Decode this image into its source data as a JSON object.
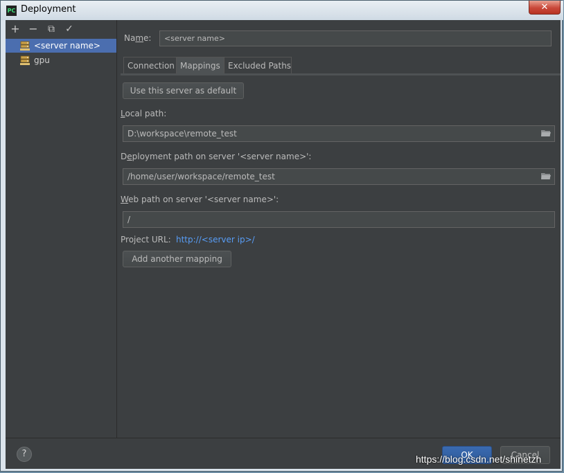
{
  "window": {
    "title": "Deployment",
    "app_icon_text": "PC",
    "close_glyph": "✕"
  },
  "toolbar": {
    "add": "+",
    "remove": "−",
    "copy": "⧉",
    "apply": "✓"
  },
  "servers": [
    {
      "label": "<server name>",
      "selected": true,
      "icon": "server-icon"
    },
    {
      "label": "gpu",
      "selected": false,
      "icon": "server-icon"
    }
  ],
  "form": {
    "name_label_pre": "Na",
    "name_label_mnemonic": "m",
    "name_label_post": "e:",
    "name_value": "<server name>"
  },
  "tabs": [
    {
      "label": "Connection",
      "active": false
    },
    {
      "label": "Mappings",
      "active": true
    },
    {
      "label": "Excluded Paths",
      "active": false
    }
  ],
  "mappings": {
    "default_button": "Use this server as default",
    "local_path_mnemonic": "L",
    "local_path_rest": "ocal path:",
    "local_path_value": "D:\\workspace\\remote_test",
    "deploy_path_pre": "D",
    "deploy_path_mnemonic": "e",
    "deploy_path_rest": "ployment path on server '<server name>':",
    "deploy_path_value": "/home/user/workspace/remote_test",
    "web_path_mnemonic": "W",
    "web_path_rest": "eb path on server '<server name>':",
    "web_path_value": "/",
    "project_url_label": "Project URL:",
    "project_url_value": "http://<server ip>/",
    "add_mapping_button": "Add another mapping"
  },
  "footer": {
    "help": "?",
    "ok": "OK",
    "cancel": "Cancel"
  },
  "watermark": "https://blog.csdn.net/shinetzh",
  "colors": {
    "selection": "#4b6eaf",
    "link": "#589df6",
    "ok_button": "#2e5a9a"
  }
}
